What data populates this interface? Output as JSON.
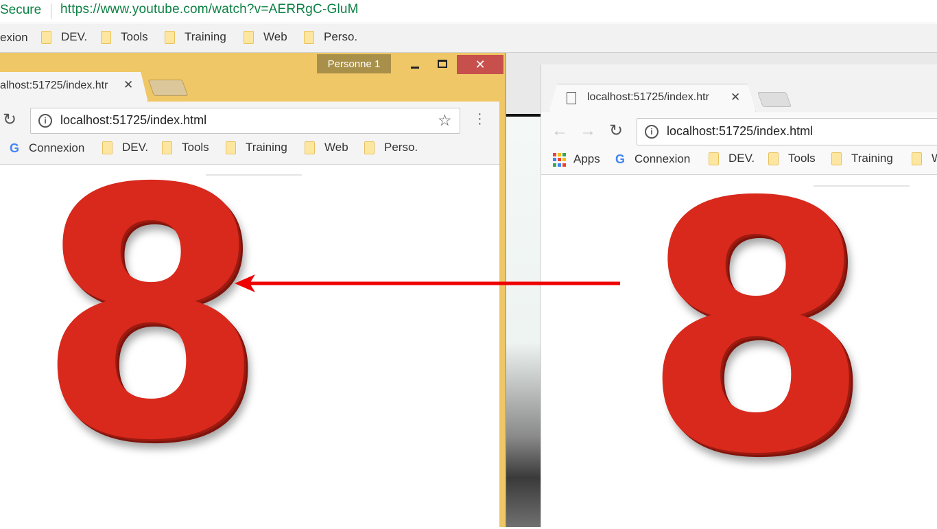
{
  "background_browser": {
    "secure_label": "Secure",
    "url": "https://www.youtube.com/watch?v=AERRgC-GluM",
    "bookmarks": [
      "exion",
      "DEV.",
      "Tools",
      "Training",
      "Web",
      "Perso."
    ]
  },
  "left_window": {
    "profile_label": "Personne 1",
    "minimize_glyph": "▁",
    "maximize_glyph": "□",
    "close_glyph": "✕",
    "tab_title": "alhost:51725/index.htr",
    "tab_close": "✕",
    "url": "localhost:51725/index.html",
    "bookmarks": [
      "Connexion",
      "DEV.",
      "Tools",
      "Training",
      "Web",
      "Perso."
    ],
    "big_number": "8"
  },
  "right_window": {
    "tab_title": "localhost:51725/index.htr",
    "tab_close": "✕",
    "url": "localhost:51725/index.html",
    "bookmarks": [
      "Apps",
      "Connexion",
      "DEV.",
      "Tools",
      "Training",
      "W"
    ],
    "big_number": "8"
  },
  "annotation": {
    "arrow_color": "#ee0000"
  },
  "colors": {
    "left_window_frame": "#f0c766",
    "close_button": "#c7504d",
    "url_green": "#0b8043",
    "digit_red": "#d8291c"
  }
}
